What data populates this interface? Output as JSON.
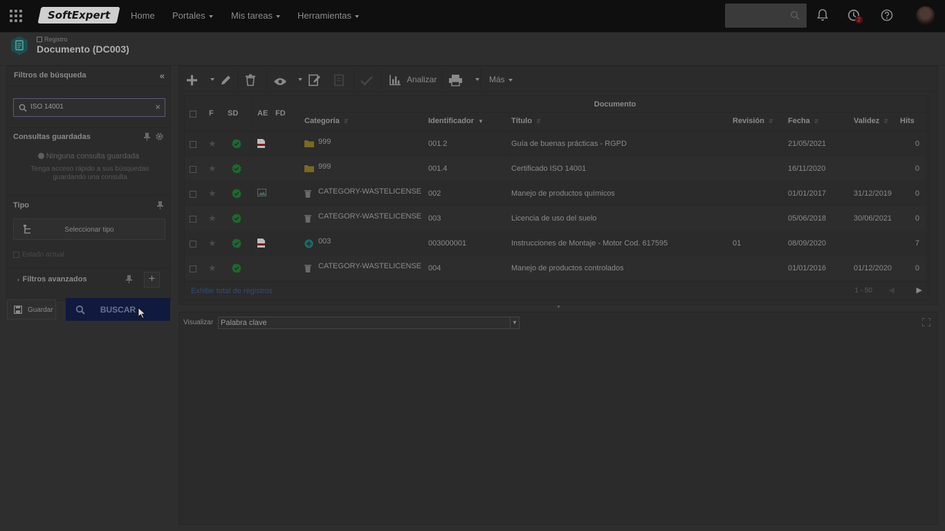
{
  "topbar": {
    "logo": "SoftExpert",
    "nav": [
      {
        "label": "Home",
        "dropdown": false
      },
      {
        "label": "Portales",
        "dropdown": true
      },
      {
        "label": "Mis tareas",
        "dropdown": true
      },
      {
        "label": "Herramientas",
        "dropdown": true
      }
    ],
    "tasks_badge": "2"
  },
  "header": {
    "breadcrumb": "Registro",
    "title": "Documento (DC003)"
  },
  "sidebar": {
    "title": "Filtros de búsqueda",
    "search_value": "ISO 14001",
    "saved_title": "Consultas guardadas",
    "saved_empty": "Ninguna consulta guardada",
    "saved_hint": "Tenga acceso rápido a sus búsquedas guardando una consulta",
    "tipo_title": "Tipo",
    "select_tipo": "Seleccionar tipo",
    "estado": "Estado actual",
    "advanced": "Filtros avanzados",
    "save_button": "Guardar",
    "search_button": "BUSCAR"
  },
  "toolbar": {
    "analyze": "Analizar",
    "more": "Más"
  },
  "grid": {
    "group_header": "Documento",
    "headers": {
      "f": "F",
      "sd": "SD",
      "ae": "AE",
      "fd": "FD",
      "categoria": "Categoría",
      "identificador": "Identificador",
      "titulo": "Título",
      "revision": "Revisión",
      "fecha": "Fecha",
      "validez": "Validez",
      "hits": "Hits"
    },
    "rows": [
      {
        "ae": "pdf",
        "cat_icon": "folder",
        "categoria": "999",
        "identificador": "001.2",
        "titulo": "Guía de buenas prácticas - RGPD",
        "revision": "",
        "fecha": "21/05/2021",
        "validez": "",
        "hits": "0"
      },
      {
        "ae": "",
        "cat_icon": "folder",
        "categoria": "999",
        "identificador": "001.4",
        "titulo": "Certificado ISO 14001",
        "revision": "",
        "fecha": "16/11/2020",
        "validez": "",
        "hits": "0"
      },
      {
        "ae": "image",
        "cat_icon": "trash",
        "categoria": "CATEGORY-WASTELICENSE",
        "identificador": "002",
        "titulo": "Manejo de productos químicos",
        "revision": "",
        "fecha": "01/01/2017",
        "validez": "31/12/2019",
        "hits": "0"
      },
      {
        "ae": "",
        "cat_icon": "trash",
        "categoria": "CATEGORY-WASTELICENSE",
        "identificador": "003",
        "titulo": "Licencia de uso del suelo",
        "revision": "",
        "fecha": "05/06/2018",
        "validez": "30/06/2021",
        "hits": "0"
      },
      {
        "ae": "pdf",
        "cat_icon": "plus-circle",
        "categoria": "003",
        "identificador": "003000001",
        "titulo": "Instrucciones de Montaje - Motor Cod. 617595",
        "revision": "01",
        "fecha": "08/09/2020",
        "validez": "",
        "hits": "7"
      },
      {
        "ae": "",
        "cat_icon": "trash",
        "categoria": "CATEGORY-WASTELICENSE",
        "identificador": "004",
        "titulo": "Manejo de productos controlados",
        "revision": "",
        "fecha": "01/01/2016",
        "validez": "01/12/2020",
        "hits": "0"
      }
    ],
    "footer_link": "Exhibir total de registros",
    "pagination": "1 - 50"
  },
  "panel": {
    "label": "Visualizar",
    "select_value": "Palabra clave"
  }
}
